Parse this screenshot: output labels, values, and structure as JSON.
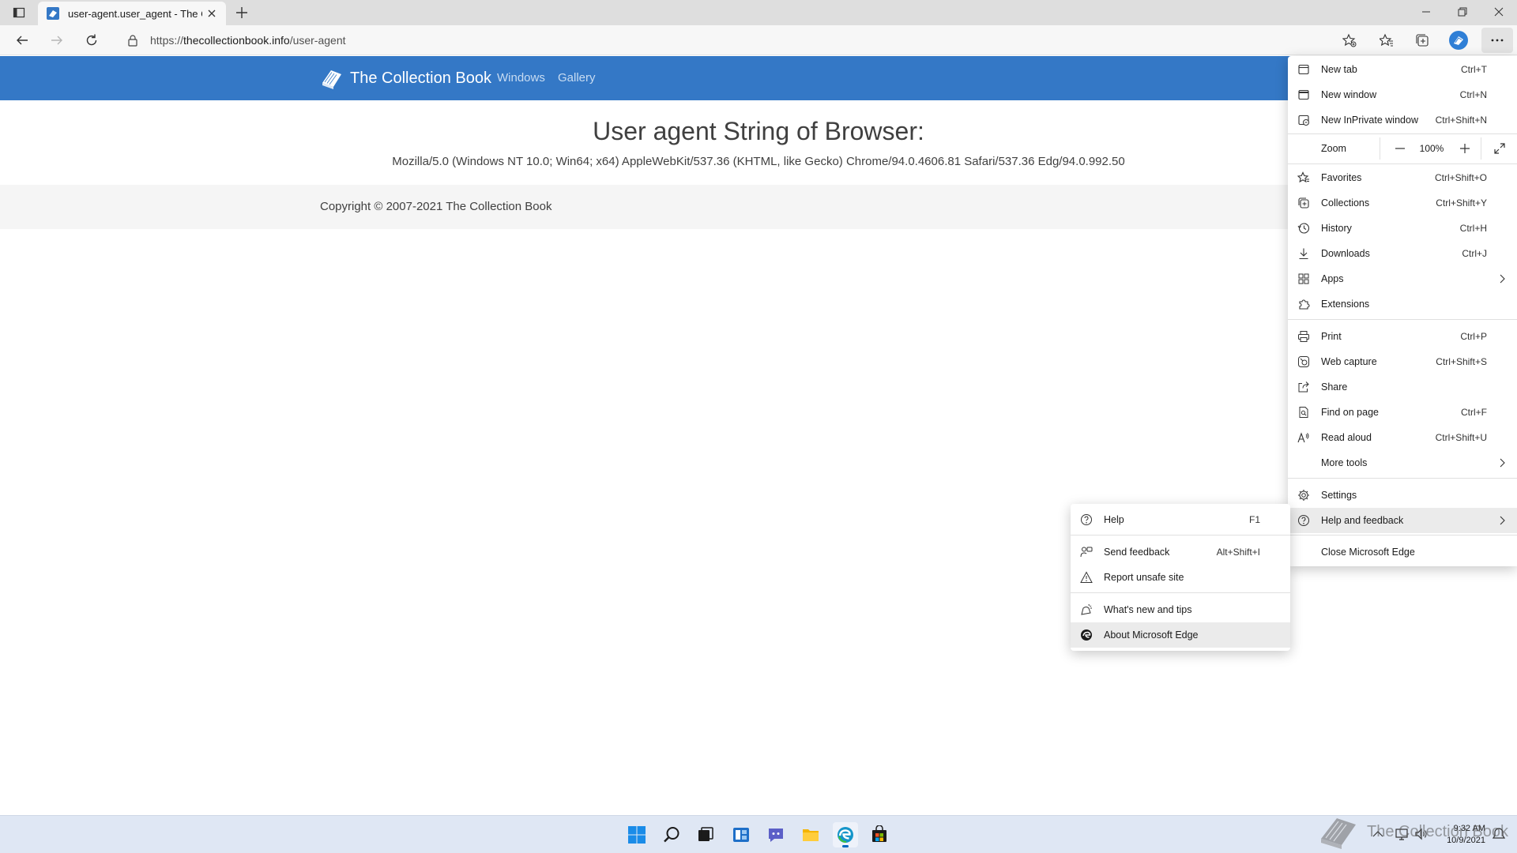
{
  "browser": {
    "tab": {
      "title": "user-agent.user_agent - The Col"
    },
    "address": {
      "scheme": "https://",
      "host": "thecollectionbook.info",
      "path": "/user-agent"
    }
  },
  "site": {
    "brand": "The Collection Book",
    "nav": [
      "Windows",
      "Gallery"
    ],
    "heading": "User agent String of Browser:",
    "user_agent": "Mozilla/5.0 (Windows NT 10.0; Win64; x64) AppleWebKit/537.36 (KHTML, like Gecko) Chrome/94.0.4606.81 Safari/537.36 Edg/94.0.992.50",
    "copyright": "Copyright © 2007-2021 The Collection Book",
    "header_color": "#3478c6"
  },
  "menu": {
    "new_tab": {
      "label": "New tab",
      "shortcut": "Ctrl+T",
      "icon": "new-tab-icon"
    },
    "new_window": {
      "label": "New window",
      "shortcut": "Ctrl+N",
      "icon": "new-window-icon"
    },
    "new_inprivate": {
      "label": "New InPrivate window",
      "shortcut": "Ctrl+Shift+N",
      "icon": "inprivate-icon"
    },
    "zoom": {
      "label": "Zoom",
      "value": "100%"
    },
    "favorites": {
      "label": "Favorites",
      "shortcut": "Ctrl+Shift+O",
      "icon": "favorites-icon"
    },
    "collections": {
      "label": "Collections",
      "shortcut": "Ctrl+Shift+Y",
      "icon": "collections-icon"
    },
    "history": {
      "label": "History",
      "shortcut": "Ctrl+H",
      "icon": "history-icon"
    },
    "downloads": {
      "label": "Downloads",
      "shortcut": "Ctrl+J",
      "icon": "download-icon"
    },
    "apps": {
      "label": "Apps",
      "icon": "apps-icon"
    },
    "extensions": {
      "label": "Extensions",
      "icon": "extensions-icon"
    },
    "print": {
      "label": "Print",
      "shortcut": "Ctrl+P",
      "icon": "print-icon"
    },
    "web_capture": {
      "label": "Web capture",
      "shortcut": "Ctrl+Shift+S",
      "icon": "web-capture-icon"
    },
    "share": {
      "label": "Share",
      "icon": "share-icon"
    },
    "find": {
      "label": "Find on page",
      "shortcut": "Ctrl+F",
      "icon": "find-icon"
    },
    "read_aloud": {
      "label": "Read aloud",
      "shortcut": "Ctrl+Shift+U",
      "icon": "read-aloud-icon"
    },
    "more_tools": {
      "label": "More tools"
    },
    "settings": {
      "label": "Settings",
      "icon": "gear-icon"
    },
    "help_feedback": {
      "label": "Help and feedback",
      "icon": "help-icon"
    },
    "close_edge": {
      "label": "Close Microsoft Edge"
    }
  },
  "submenu": {
    "help": {
      "label": "Help",
      "shortcut": "F1",
      "icon": "help-icon"
    },
    "send_feedback": {
      "label": "Send feedback",
      "shortcut": "Alt+Shift+I",
      "icon": "feedback-icon"
    },
    "report_unsafe": {
      "label": "Report unsafe site",
      "icon": "warning-icon"
    },
    "whats_new": {
      "label": "What's new and tips",
      "icon": "whats-new-icon"
    },
    "about_edge": {
      "label": "About Microsoft Edge",
      "icon": "edge-icon"
    }
  },
  "taskbar": {
    "time": "9:32 AM",
    "date": "10/9/2021",
    "watermark": "The Collection Book"
  }
}
